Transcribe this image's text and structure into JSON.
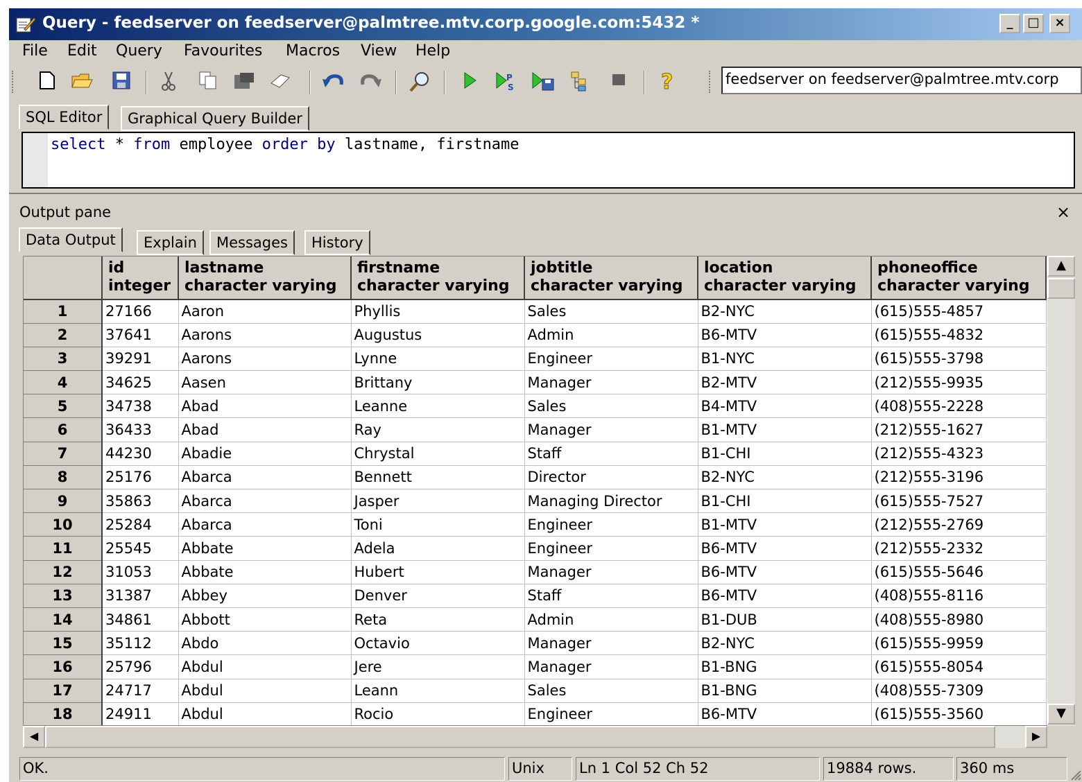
{
  "window": {
    "title": "Query - feedserver on feedserver@palmtree.mtv.corp.google.com:5432 *",
    "minimize": "_",
    "maximize": "□",
    "close": "×"
  },
  "menu": [
    "File",
    "Edit",
    "Query",
    "Favourites",
    "Macros",
    "View",
    "Help"
  ],
  "toolbar": {
    "connection": "feedserver on feedserver@palmtree.mtv.corp"
  },
  "editor_tabs": [
    "SQL Editor",
    "Graphical Query Builder"
  ],
  "sql": {
    "kw1": "select",
    "rest1": " * ",
    "kw2": "from",
    "rest2": " employee ",
    "kw3": "order by",
    "rest3": " lastname, firstname"
  },
  "output": {
    "title": "Output pane",
    "close": "×",
    "tabs": [
      "Data Output",
      "Explain",
      "Messages",
      "History"
    ]
  },
  "columns": [
    {
      "name": "id",
      "type": "integer"
    },
    {
      "name": "lastname",
      "type": "character varying"
    },
    {
      "name": "firstname",
      "type": "character varying"
    },
    {
      "name": "jobtitle",
      "type": "character varying"
    },
    {
      "name": "location",
      "type": "character varying"
    },
    {
      "name": "phoneoffice",
      "type": "character varying"
    }
  ],
  "rows": [
    [
      "1",
      "27166",
      "Aaron",
      "Phyllis",
      "Sales",
      "B2-NYC",
      "(615)555-4857"
    ],
    [
      "2",
      "37641",
      "Aarons",
      "Augustus",
      "Admin",
      "B6-MTV",
      "(615)555-4832"
    ],
    [
      "3",
      "39291",
      "Aarons",
      "Lynne",
      "Engineer",
      "B1-NYC",
      "(615)555-3798"
    ],
    [
      "4",
      "34625",
      "Aasen",
      "Brittany",
      "Manager",
      "B2-MTV",
      "(212)555-9935"
    ],
    [
      "5",
      "34738",
      "Abad",
      "Leanne",
      "Sales",
      "B4-MTV",
      "(408)555-2228"
    ],
    [
      "6",
      "36433",
      "Abad",
      "Ray",
      "Manager",
      "B1-MTV",
      "(212)555-1627"
    ],
    [
      "7",
      "44230",
      "Abadie",
      "Chrystal",
      "Staff",
      "B1-CHI",
      "(212)555-4323"
    ],
    [
      "8",
      "25176",
      "Abarca",
      "Bennett",
      "Director",
      "B2-NYC",
      "(212)555-3196"
    ],
    [
      "9",
      "35863",
      "Abarca",
      "Jasper",
      "Managing Director",
      "B1-CHI",
      "(615)555-7527"
    ],
    [
      "10",
      "25284",
      "Abarca",
      "Toni",
      "Engineer",
      "B1-MTV",
      "(212)555-2769"
    ],
    [
      "11",
      "25545",
      "Abbate",
      "Adela",
      "Engineer",
      "B6-MTV",
      "(212)555-2332"
    ],
    [
      "12",
      "31053",
      "Abbate",
      "Hubert",
      "Manager",
      "B6-MTV",
      "(615)555-5646"
    ],
    [
      "13",
      "31387",
      "Abbey",
      "Denver",
      "Staff",
      "B6-MTV",
      "(408)555-8116"
    ],
    [
      "14",
      "34861",
      "Abbott",
      "Reta",
      "Admin",
      "B1-DUB",
      "(408)555-8980"
    ],
    [
      "15",
      "35112",
      "Abdo",
      "Octavio",
      "Manager",
      "B2-NYC",
      "(615)555-9959"
    ],
    [
      "16",
      "25796",
      "Abdul",
      "Jere",
      "Manager",
      "B1-BNG",
      "(615)555-8054"
    ],
    [
      "17",
      "24717",
      "Abdul",
      "Leann",
      "Sales",
      "B1-BNG",
      "(408)555-7309"
    ],
    [
      "18",
      "24911",
      "Abdul",
      "Rocio",
      "Engineer",
      "B6-MTV",
      "(615)555-3560"
    ]
  ],
  "status": {
    "message": "OK.",
    "line_endings": "Unix",
    "position": "Ln 1 Col 52 Ch 52",
    "rows": "19884 rows.",
    "time": "360 ms"
  }
}
